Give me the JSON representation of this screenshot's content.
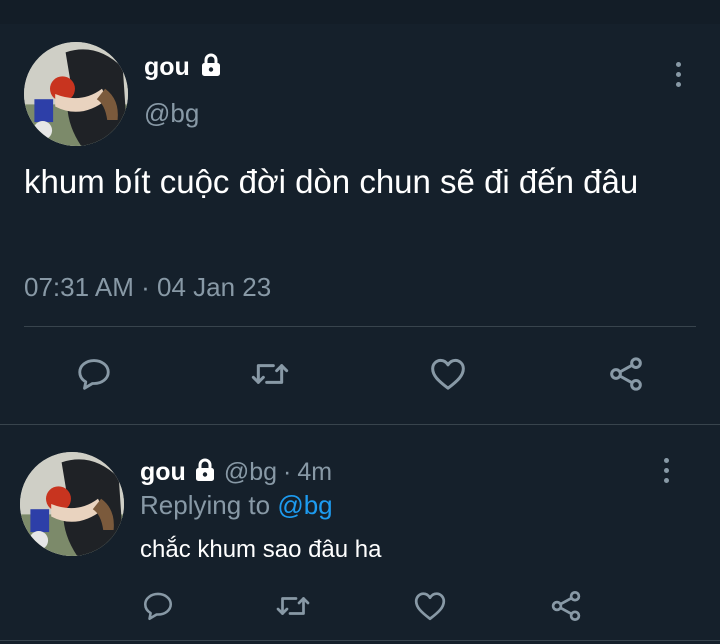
{
  "main_tweet": {
    "name": "gou",
    "handle": "@bg",
    "text": "khum bít cuộc đời dòn chun sẽ đi đến đâu",
    "time": "07:31 AM",
    "separator": "·",
    "date": "04 Jan 23"
  },
  "reply_tweet": {
    "name": "gou",
    "handle": "@bg",
    "separator": "·",
    "age": "4m",
    "replying_prefix": "Replying to",
    "replying_handle": "@bg",
    "text": "chắc khum sao đâu ha"
  },
  "icons": {
    "reply": "reply-icon",
    "retweet": "retweet-icon",
    "like": "heart-icon",
    "share": "share-icon",
    "more": "more-vertical-icon",
    "lock": "lock-icon"
  },
  "colors": {
    "background": "#15202b",
    "secondary_text": "#8899a6",
    "divider": "#38444d",
    "link": "#1d9bf0"
  }
}
